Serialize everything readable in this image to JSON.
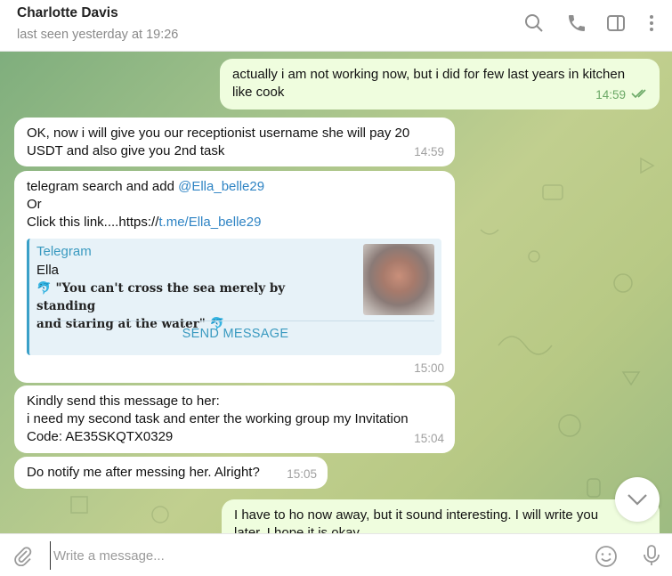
{
  "header": {
    "name": "Charlotte Davis",
    "status": "last seen yesterday at 19:26",
    "icons": [
      "search-icon",
      "phone-icon",
      "sidebar-toggle-icon",
      "more-vertical-icon"
    ]
  },
  "messages": [
    {
      "direction": "out",
      "text_1": "actually i am not working now, but i did for few last years in kitchen",
      "text_2": "like cook",
      "time": "14:59",
      "status": "read"
    },
    {
      "direction": "in",
      "text_1": "OK, now i will give you our receptionist username she will pay 20",
      "text_2": "USDT and also give you 2nd task",
      "time": "14:59"
    },
    {
      "direction": "in",
      "line1_prefix": "telegram search and add ",
      "line1_link": "@Ella_belle29",
      "line2": "Or",
      "line3_prefix": "Click this link....https://",
      "line3_link": "t.me/Ella_belle29",
      "preview": {
        "site": "Telegram",
        "title": "Ella",
        "desc_1": "\"You can't cross the sea merely by standing",
        "desc_2": "and staring at the water\"",
        "emoji": "🐬",
        "button": "SEND MESSAGE"
      },
      "time": "15:00"
    },
    {
      "direction": "in",
      "text_1": "Kindly send this message to her:",
      "text_2": "i need my second task and enter the working group my Invitation",
      "text_3": "Code: AE35SKQTX0329",
      "time": "15:04"
    },
    {
      "direction": "in",
      "text_1": "Do notify me after messing her. Alright?",
      "time": "15:05"
    },
    {
      "direction": "out",
      "text_1": "I have to ho now away, but it sound interesting. I will write you",
      "text_2": "later. I hope it is okay"
    }
  ],
  "composer": {
    "placeholder": "Write a message..."
  },
  "colors": {
    "outgoing_bubble": "#effdde",
    "incoming_bubble": "#ffffff",
    "link": "#2f84c4",
    "read_ticks": "#6aa865"
  }
}
